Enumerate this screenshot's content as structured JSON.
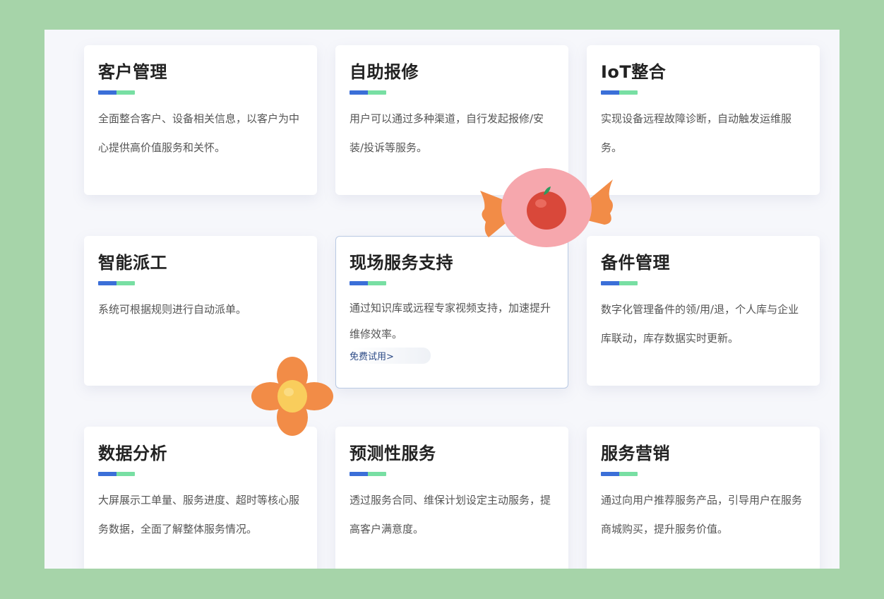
{
  "cards": [
    {
      "title": "客户管理",
      "desc": "全面整合客户、设备相关信息，以客户为中心提供高价值服务和关怀。"
    },
    {
      "title": "自助报修",
      "desc": "用户可以通过多种渠道，自行发起报修/安装/投诉等服务。"
    },
    {
      "title": "IoT整合",
      "desc": "实现设备远程故障诊断，自动触发运维服务。"
    },
    {
      "title": "智能派工",
      "desc": "系统可根据规则进行自动派单。"
    },
    {
      "title": "现场服务支持",
      "desc": "通过知识库或远程专家视频支持，加速提升维修效率。",
      "link": "免费试用>"
    },
    {
      "title": "备件管理",
      "desc": "数字化管理备件的领/用/退，个人库与企业库联动，库存数据实时更新。"
    },
    {
      "title": "数据分析",
      "desc": "大屏展示工单量、服务进度、超时等核心服务数据，全面了解整体服务情况。"
    },
    {
      "title": "预测性服务",
      "desc": "透过服务合同、维保计划设定主动服务，提高客户满意度。"
    },
    {
      "title": "服务营销",
      "desc": "通过向用户推荐服务产品，引导用户在服务商城购买，提升服务价值。"
    }
  ],
  "colors": {
    "background": "#a6d4a9",
    "accent_blue": "#3b6fd8",
    "accent_green": "#78dfa3",
    "link": "#2c4a86"
  }
}
